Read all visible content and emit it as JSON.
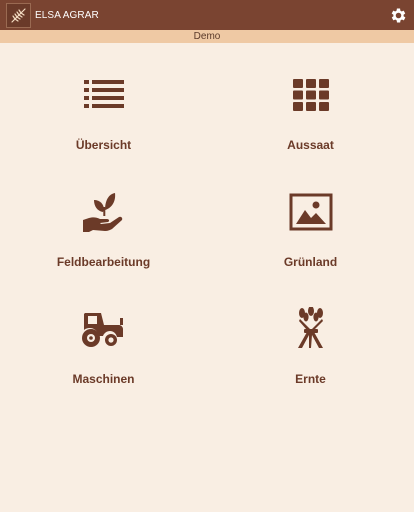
{
  "app": {
    "title": "ELSA AGRAR",
    "mode_banner": "Demo"
  },
  "colors": {
    "appbar": "#7a4431",
    "banner": "#efc9a4",
    "background": "#f9eee3",
    "accent": "#6b3a28"
  },
  "tiles": [
    {
      "label": "Übersicht",
      "icon": "list-icon"
    },
    {
      "label": "Aussaat",
      "icon": "grid-icon"
    },
    {
      "label": "Feldbearbeitung",
      "icon": "hand-plant-icon"
    },
    {
      "label": "Grünland",
      "icon": "landscape-image-icon"
    },
    {
      "label": "Maschinen",
      "icon": "tractor-icon"
    },
    {
      "label": "Ernte",
      "icon": "wheat-sheaf-icon"
    }
  ]
}
